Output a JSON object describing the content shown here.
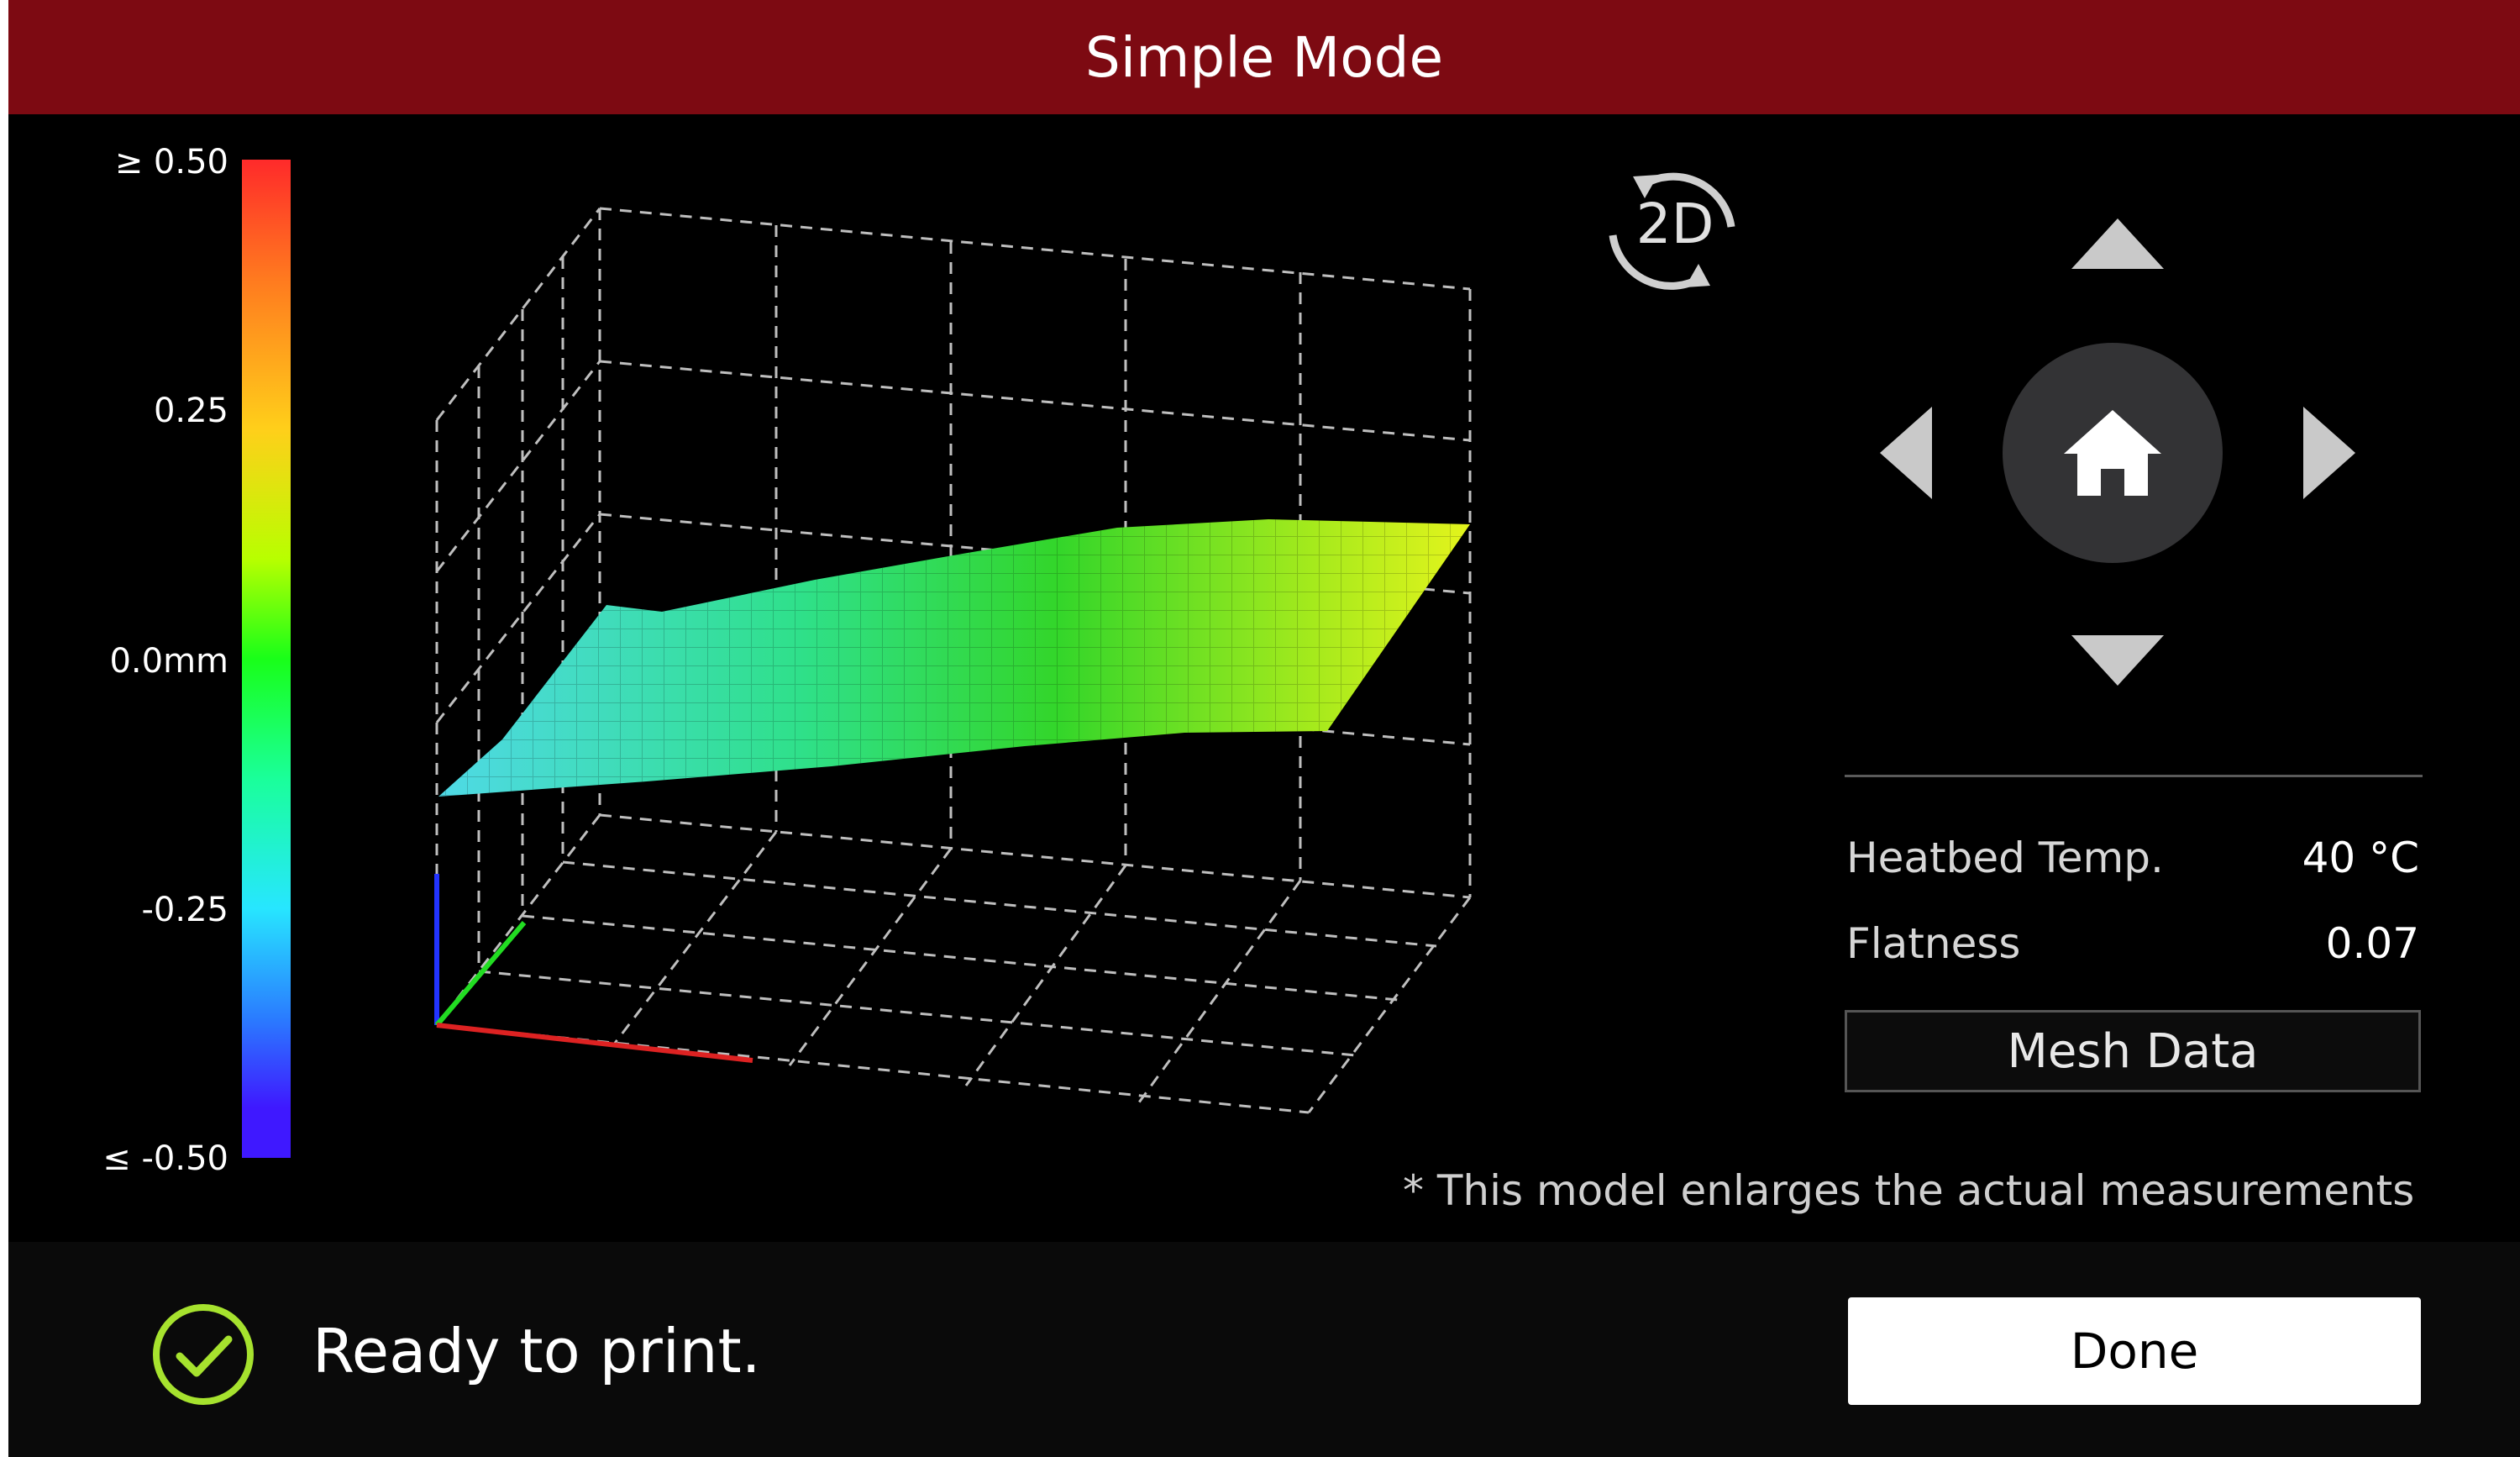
{
  "header": {
    "title": "Simple Mode"
  },
  "legend": {
    "max_label": "≥ 0.50",
    "upper_label": "0.25",
    "mid_label": "0.0mm",
    "lower_label": "-0.25",
    "min_label": "≤ -0.50"
  },
  "view_toggle": {
    "label": "2D",
    "icon": "rotate-icon"
  },
  "controls": {
    "home_icon": "home-icon",
    "up_icon": "arrow-up-icon",
    "down_icon": "arrow-down-icon",
    "left_icon": "arrow-left-icon",
    "right_icon": "arrow-right-icon"
  },
  "info": {
    "heatbed_label": "Heatbed Temp.",
    "heatbed_value": "40 °C",
    "flatness_label": "Flatness",
    "flatness_value": "0.07",
    "mesh_button": "Mesh Data",
    "note": "* This model enlarges the actual measurements"
  },
  "status": {
    "text": "Ready to print.",
    "icon": "check-circle-icon"
  },
  "footer": {
    "done_button": "Done"
  },
  "colors": {
    "title_bar": "#7d0a12",
    "check": "#a6e22e",
    "surface_low": "#40d9d6",
    "surface_mid": "#22cc22",
    "surface_high": "#d8f21c"
  }
}
